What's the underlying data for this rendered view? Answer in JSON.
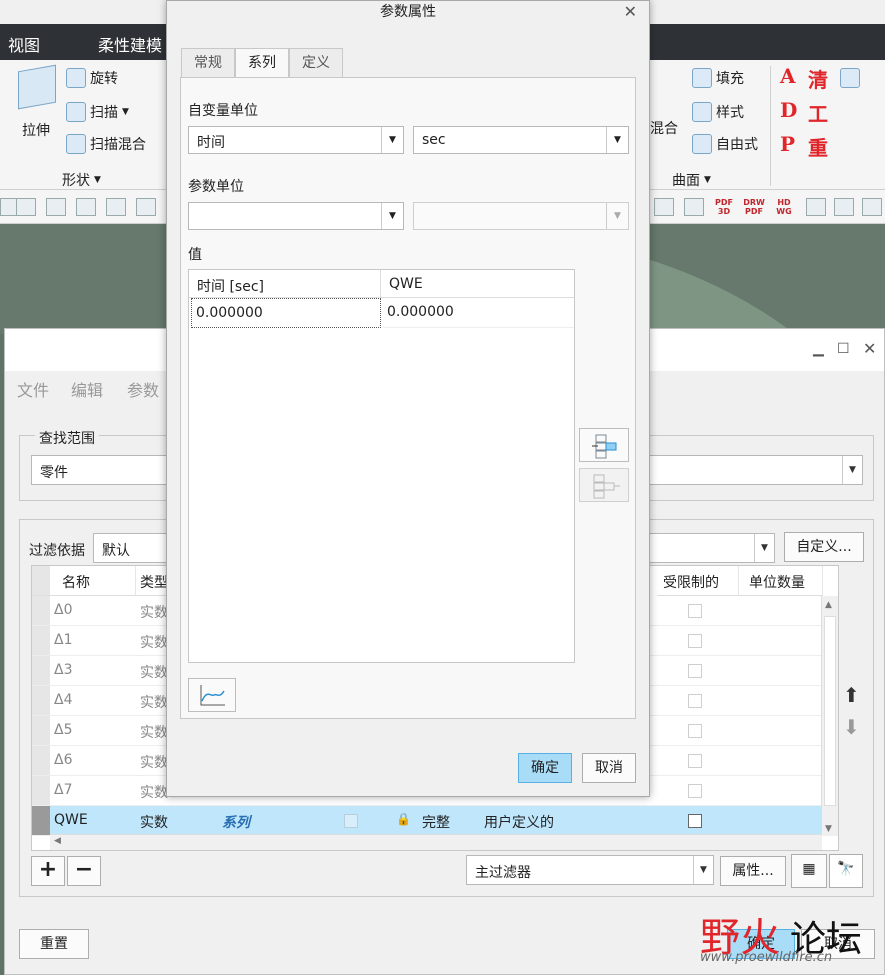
{
  "app_menu": {
    "view": "视图",
    "flex_modeling": "柔性建模"
  },
  "ribbon": {
    "extrude": "拉伸",
    "revolve": "旋转",
    "sweep": "扫描",
    "swept_blend": "扫描混合",
    "shape_group": "形状",
    "blend": "混合",
    "fill": "填充",
    "style": "样式",
    "freestyle": "自由式",
    "surface_group": "曲面",
    "red_letters": [
      "A",
      "清",
      "D",
      "工",
      "P",
      "重"
    ]
  },
  "toolbar_pdf": [
    "PDF 3D",
    "DRW PDF",
    "HD WG"
  ],
  "params_dialog": {
    "menus": [
      "文件",
      "编辑",
      "参数"
    ],
    "lookin_group": "查找范围",
    "lookin_value": "零件",
    "filter_label": "过滤依据",
    "filter_value": "默认",
    "customize": "自定义...",
    "columns": [
      "名称",
      "类型",
      "受限制的",
      "单位数量"
    ],
    "rows": [
      {
        "name": "Δ0",
        "type": "实数"
      },
      {
        "name": "Δ1",
        "type": "实数"
      },
      {
        "name": "Δ3",
        "type": "实数"
      },
      {
        "name": "Δ4",
        "type": "实数"
      },
      {
        "name": "Δ5",
        "type": "实数"
      },
      {
        "name": "Δ6",
        "type": "实数"
      },
      {
        "name": "Δ7",
        "type": "实数"
      }
    ],
    "selected_row": {
      "name": "QWE",
      "type": "实数",
      "value": "系列",
      "status": "完整",
      "source": "用户定义的"
    },
    "main_filter": "主过滤器",
    "properties": "属性...",
    "reset": "重置",
    "ok": "确定",
    "cancel": "取消"
  },
  "dialog": {
    "title": "参数属性",
    "tabs": [
      "常规",
      "系列",
      "定义"
    ],
    "indep_unit_label": "自变量单位",
    "indep_quantity": "时间",
    "indep_unit": "sec",
    "param_unit_label": "参数单位",
    "param_quantity": "",
    "param_unit": "",
    "values_label": "值",
    "table_headers": [
      "时间 [sec]",
      "QWE"
    ],
    "table_row": [
      "0.000000",
      "0.000000"
    ],
    "ok": "确定",
    "cancel": "取消"
  },
  "watermark": {
    "part1": "野火",
    "part2": "论坛",
    "url": "www.proewildfire.cn"
  }
}
